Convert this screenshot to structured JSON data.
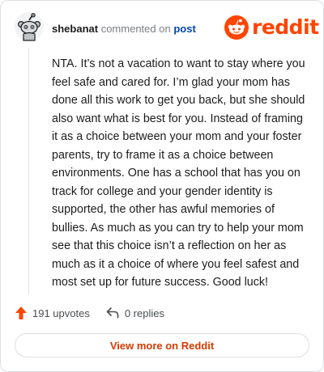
{
  "header": {
    "username": "shebanat",
    "action_text": "commented on",
    "post_link": "post"
  },
  "brand": {
    "wordmark": "reddit",
    "icon": "reddit-snoo-icon",
    "color": "#ff4500"
  },
  "avatar": {
    "icon": "snoo-avatar-icon"
  },
  "comment": {
    "body": "NTA. It’s not a vacation to want to stay where you feel safe and cared for. I’m glad your mom has done all this work to get you back, but she should also want what is best for you. Instead of framing it as a choice between your mom and your foster parents, try to frame it as a choice between environments. One has a school that has you on track for college and your gender identity is supported, the other has awful memories of bullies. As much as you can try to help your mom see that this choice isn’t a reflection on her as much as it a choice of where you feel safest and most set up for future success. Good luck!"
  },
  "actions": {
    "upvotes": "191 upvotes",
    "upvote_icon": "upvote-arrow-icon",
    "replies": "0 replies",
    "reply_icon": "reply-arrow-icon",
    "upvote_color": "#ff4500"
  },
  "cta": {
    "label": "View more on Reddit",
    "color": "#d93a00"
  }
}
